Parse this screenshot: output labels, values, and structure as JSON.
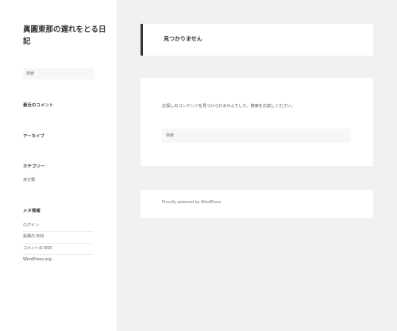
{
  "site": {
    "title": "眞圓東那の遅れをとる日記"
  },
  "sidebar": {
    "search_placeholder": "検索",
    "recent_comments_title": "最近のコメント",
    "archives_title": "アーカイブ",
    "categories_title": "カテゴリー",
    "categories": [
      {
        "label": "未分類"
      }
    ],
    "meta_title": "メタ情報",
    "meta_links": [
      {
        "label": "ログイン"
      },
      {
        "label": "投稿の RSS"
      },
      {
        "label": "コメントの RSS"
      },
      {
        "label": "WordPress.org"
      }
    ]
  },
  "main": {
    "page_title": "見つかりません",
    "message": "お探しのコンテンツを見つけられませんでした。検索をお試しください。",
    "search_placeholder": "検索"
  },
  "footer": {
    "credit": "Proudly powered by WordPress"
  }
}
